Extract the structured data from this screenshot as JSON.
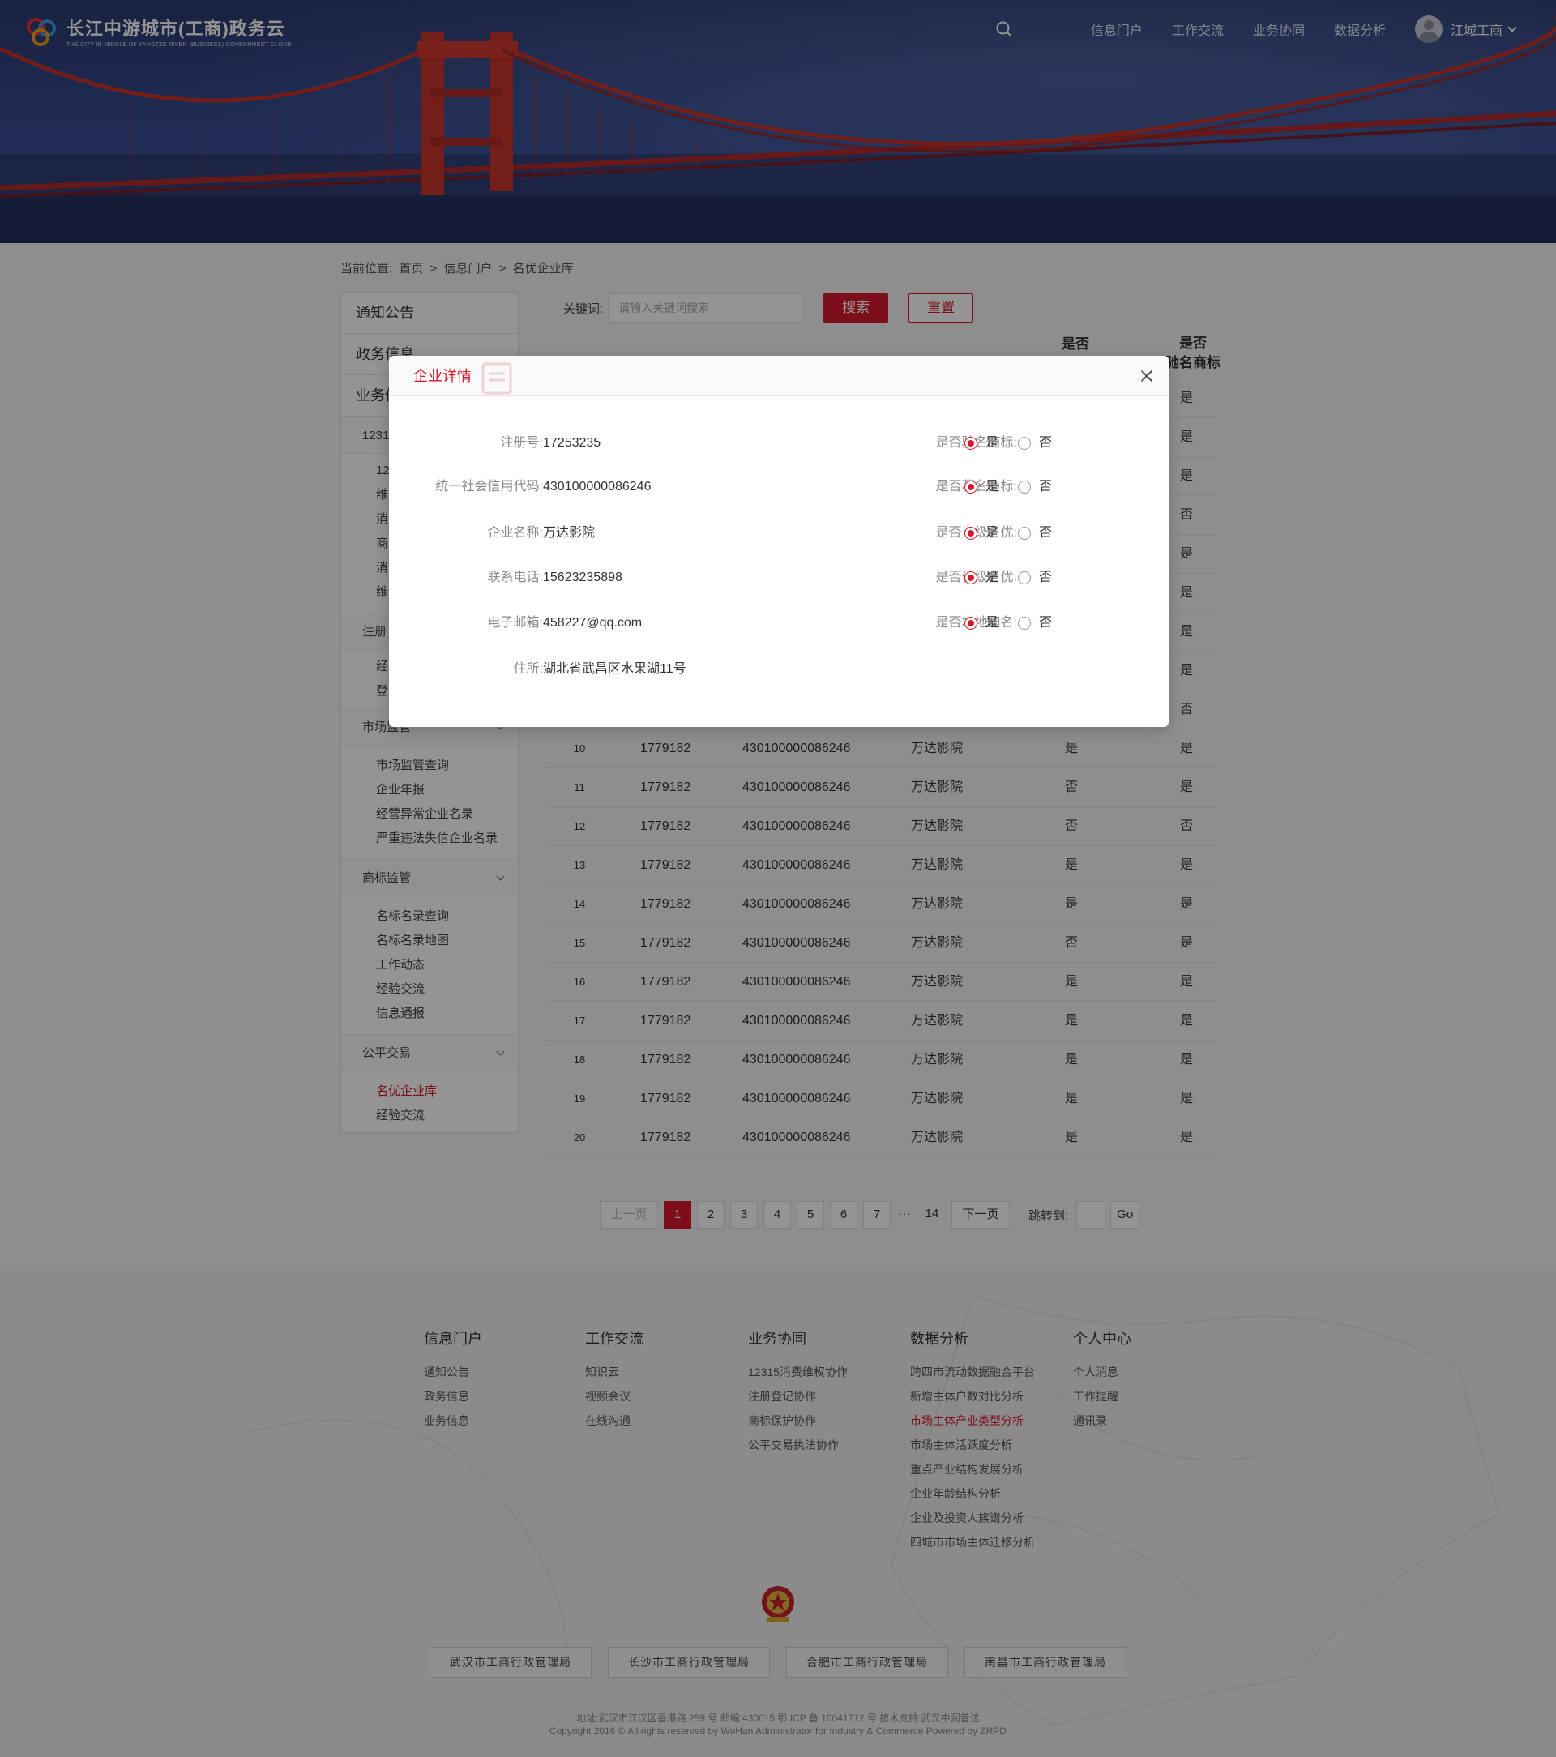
{
  "header": {
    "logo_title": "长江中游城市(工商)政务云",
    "logo_sub": "THE CITY IN MIDDLE OF YANGTZE RIVER (BUSINESS) GOVERNMENT CLOUD",
    "nav": [
      "信息门户",
      "工作交流",
      "业务协同",
      "数据分析"
    ],
    "user_name": "江城工商"
  },
  "breadcrumb": {
    "prefix": "当前位置:",
    "items": [
      "首页",
      "信息门户",
      "名优企业库"
    ],
    "sep": ">"
  },
  "sidebar": {
    "top_items": [
      "通知公告",
      "政务信息",
      "业务信息"
    ],
    "partial_items": [
      "1231",
      "12",
      "维",
      "消",
      "商",
      "消",
      "维",
      "注册",
      "经",
      "登"
    ],
    "groups": [
      {
        "title": "市场监管",
        "items": [
          "市场监管查询",
          "企业年报",
          "经营异常企业名录",
          "严重违法失信企业名录"
        ]
      },
      {
        "title": "商标监管",
        "items": [
          "名标名录查询",
          "名标名录地图",
          "工作动态",
          "经验交流",
          "信息通报"
        ]
      },
      {
        "title": "公平交易",
        "items": [
          "名优企业库",
          "经验交流"
        ]
      }
    ]
  },
  "search": {
    "label": "关键词:",
    "placeholder": "请输入关键词搜索",
    "search_btn": "搜索",
    "reset_btn": "重置"
  },
  "table": {
    "headers": {
      "col5": "是否",
      "col6a": "是否",
      "col6b": "驰名商标"
    },
    "partial_col6": [
      "是",
      "是",
      "是",
      "否",
      "是",
      "是",
      "是",
      "是",
      "否"
    ],
    "rows": [
      {
        "n": "10",
        "reg": "1779182",
        "code": "430100000086246",
        "name": "万达影院",
        "a": "是",
        "b": "是"
      },
      {
        "n": "11",
        "reg": "1779182",
        "code": "430100000086246",
        "name": "万达影院",
        "a": "否",
        "b": "是"
      },
      {
        "n": "12",
        "reg": "1779182",
        "code": "430100000086246",
        "name": "万达影院",
        "a": "否",
        "b": "否"
      },
      {
        "n": "13",
        "reg": "1779182",
        "code": "430100000086246",
        "name": "万达影院",
        "a": "是",
        "b": "是"
      },
      {
        "n": "14",
        "reg": "1779182",
        "code": "430100000086246",
        "name": "万达影院",
        "a": "是",
        "b": "是"
      },
      {
        "n": "15",
        "reg": "1779182",
        "code": "430100000086246",
        "name": "万达影院",
        "a": "否",
        "b": "是"
      },
      {
        "n": "16",
        "reg": "1779182",
        "code": "430100000086246",
        "name": "万达影院",
        "a": "是",
        "b": "是"
      },
      {
        "n": "17",
        "reg": "1779182",
        "code": "430100000086246",
        "name": "万达影院",
        "a": "是",
        "b": "是"
      },
      {
        "n": "18",
        "reg": "1779182",
        "code": "430100000086246",
        "name": "万达影院",
        "a": "是",
        "b": "是"
      },
      {
        "n": "19",
        "reg": "1779182",
        "code": "430100000086246",
        "name": "万达影院",
        "a": "是",
        "b": "是"
      },
      {
        "n": "20",
        "reg": "1779182",
        "code": "430100000086246",
        "name": "万达影院",
        "a": "是",
        "b": "是"
      }
    ]
  },
  "pager": {
    "prev": "上一页",
    "pages": [
      "1",
      "2",
      "3",
      "4",
      "5",
      "6",
      "7"
    ],
    "ellipsis": "···",
    "last": "14",
    "next": "下一页",
    "jump_label": "跳转到:",
    "go": "Go"
  },
  "footer": {
    "cols": [
      {
        "title": "信息门户",
        "items": [
          "通知公告",
          "政务信息",
          "业务信息"
        ]
      },
      {
        "title": "工作交流",
        "items": [
          "知识云",
          "视频会议",
          "在线沟通"
        ]
      },
      {
        "title": "业务协同",
        "items": [
          "12315消费维权协作",
          "注册登记协作",
          "商标保护协作",
          "公平交易执法协作"
        ]
      },
      {
        "title": "数据分析",
        "items": [
          "跨四市流动数据融合平台",
          "新增主体户数对比分析",
          "市场主体产业类型分析",
          "市场主体活跃度分析",
          "重点产业结构发展分析",
          "企业年龄结构分析",
          "企业及投资人族谱分析",
          "四城市市场主体迁移分析"
        ]
      },
      {
        "title": "个人中心",
        "items": [
          "个人消息",
          "工作提醒",
          "通讯录"
        ]
      }
    ],
    "cities": [
      "武汉市工商行政管理局",
      "长沙市工商行政管理局",
      "合肥市工商行政管理局",
      "南昌市工商行政管理局"
    ],
    "line1": "地址:武汉市江汉区香港路 259 号    邮编:430015    鄂 ICP 备 10041712 号    技术支持:武汉中润普达",
    "line2": "Copyright 2016 © All rights reserved by WuHan Administrator for Industry & Commerce    Powered by ZRPD",
    "highlight_color": "#d7182a"
  },
  "modal": {
    "title": "企业详情",
    "left_fields": [
      {
        "label": "注册号:",
        "value": "17253235"
      },
      {
        "label": "统一社会信用代码:",
        "value": "430100000086246"
      },
      {
        "label": "企业名称:",
        "value": "万达影院"
      },
      {
        "label": "联系电话:",
        "value": "15623235898"
      },
      {
        "label": "电子邮箱:",
        "value": "458227@qq.com"
      },
      {
        "label": "住所:",
        "value": "湖北省武昌区水果湖11号"
      }
    ],
    "right_fields": [
      {
        "label": "是否驰名商标:",
        "yes": "是",
        "no": "否",
        "selected": "是"
      },
      {
        "label": "是否著名商标:",
        "yes": "是",
        "no": "否",
        "selected": "是"
      },
      {
        "label": "是否市级名优:",
        "yes": "是",
        "no": "否",
        "selected": "是"
      },
      {
        "label": "是否省级名优:",
        "yes": "是",
        "no": "否",
        "selected": "是"
      },
      {
        "label": "是否本地知名:",
        "yes": "是",
        "no": "否",
        "selected": "是"
      }
    ]
  },
  "colors": {
    "accent": "#d7182a",
    "header_bg": "#34488a"
  }
}
